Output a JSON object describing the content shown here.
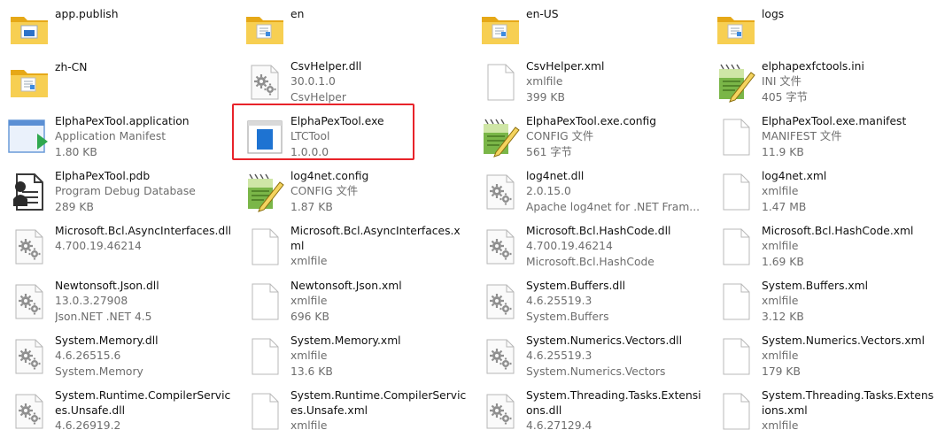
{
  "items": [
    {
      "kind": "folder",
      "variant": "blue",
      "name": "app.publish",
      "lines": []
    },
    {
      "kind": "folder",
      "variant": "doc",
      "name": "en",
      "lines": []
    },
    {
      "kind": "folder",
      "variant": "doc",
      "name": "en-US",
      "lines": []
    },
    {
      "kind": "folder",
      "variant": "doc",
      "name": "logs",
      "lines": []
    },
    {
      "kind": "folder",
      "variant": "doc",
      "name": "zh-CN",
      "lines": []
    },
    {
      "kind": "dll",
      "name": "CsvHelper.dll",
      "lines": [
        "30.0.1.0",
        "CsvHelper"
      ]
    },
    {
      "kind": "blank",
      "name": "CsvHelper.xml",
      "lines": [
        "xmlfile",
        "399 KB"
      ]
    },
    {
      "kind": "notepad",
      "name": "elphapexfctools.ini",
      "lines": [
        "INI 文件",
        "405 字节"
      ]
    },
    {
      "kind": "app",
      "name": "ElphaPexTool.application",
      "lines": [
        "Application Manifest",
        "1.80 KB"
      ]
    },
    {
      "kind": "exe",
      "name": "ElphaPexTool.exe",
      "lines": [
        "LTCTool",
        "1.0.0.0"
      ]
    },
    {
      "kind": "notepad",
      "name": "ElphaPexTool.exe.config",
      "lines": [
        "CONFIG 文件",
        "561 字节"
      ]
    },
    {
      "kind": "blank",
      "name": "ElphaPexTool.exe.manifest",
      "lines": [
        "MANIFEST 文件",
        "11.9 KB"
      ]
    },
    {
      "kind": "pdb",
      "name": "ElphaPexTool.pdb",
      "lines": [
        "Program Debug Database",
        "289 KB"
      ]
    },
    {
      "kind": "notepad",
      "name": "log4net.config",
      "lines": [
        "CONFIG 文件",
        "1.87 KB"
      ]
    },
    {
      "kind": "dll",
      "name": "log4net.dll",
      "lines": [
        "2.0.15.0",
        "Apache log4net for .NET Fram..."
      ]
    },
    {
      "kind": "blank",
      "name": "log4net.xml",
      "lines": [
        "xmlfile",
        "1.47 MB"
      ]
    },
    {
      "kind": "dll",
      "name": "Microsoft.Bcl.AsyncInterfaces.dll",
      "lines": [
        "4.700.19.46214"
      ]
    },
    {
      "kind": "blank",
      "name": "Microsoft.Bcl.AsyncInterfaces.xml",
      "lines": [
        "xmlfile"
      ]
    },
    {
      "kind": "dll",
      "name": "Microsoft.Bcl.HashCode.dll",
      "lines": [
        "4.700.19.46214",
        "Microsoft.Bcl.HashCode"
      ]
    },
    {
      "kind": "blank",
      "name": "Microsoft.Bcl.HashCode.xml",
      "lines": [
        "xmlfile",
        "1.69 KB"
      ]
    },
    {
      "kind": "dll",
      "name": "Newtonsoft.Json.dll",
      "lines": [
        "13.0.3.27908",
        "Json.NET .NET 4.5"
      ]
    },
    {
      "kind": "blank",
      "name": "Newtonsoft.Json.xml",
      "lines": [
        "xmlfile",
        "696 KB"
      ]
    },
    {
      "kind": "dll",
      "name": "System.Buffers.dll",
      "lines": [
        "4.6.25519.3",
        "System.Buffers"
      ]
    },
    {
      "kind": "blank",
      "name": "System.Buffers.xml",
      "lines": [
        "xmlfile",
        "3.12 KB"
      ]
    },
    {
      "kind": "dll",
      "name": "System.Memory.dll",
      "lines": [
        "4.6.26515.6",
        "System.Memory"
      ]
    },
    {
      "kind": "blank",
      "name": "System.Memory.xml",
      "lines": [
        "xmlfile",
        "13.6 KB"
      ]
    },
    {
      "kind": "dll",
      "name": "System.Numerics.Vectors.dll",
      "lines": [
        "4.6.25519.3",
        "System.Numerics.Vectors"
      ]
    },
    {
      "kind": "blank",
      "name": "System.Numerics.Vectors.xml",
      "lines": [
        "xmlfile",
        "179 KB"
      ]
    },
    {
      "kind": "dll",
      "name": "System.Runtime.CompilerServices.Unsafe.dll",
      "lines": [
        "4.6.26919.2"
      ]
    },
    {
      "kind": "blank",
      "name": "System.Runtime.CompilerServices.Unsafe.xml",
      "lines": [
        "xmlfile"
      ]
    },
    {
      "kind": "dll",
      "name": "System.Threading.Tasks.Extensions.dll",
      "lines": [
        "4.6.27129.4"
      ]
    },
    {
      "kind": "blank",
      "name": "System.Threading.Tasks.Extensions.xml",
      "lines": [
        "xmlfile"
      ]
    }
  ],
  "selected_index": 9,
  "colors": {
    "highlight": "#e8232a",
    "folder": "#f4c542",
    "exe_blue": "#1e73d2"
  }
}
